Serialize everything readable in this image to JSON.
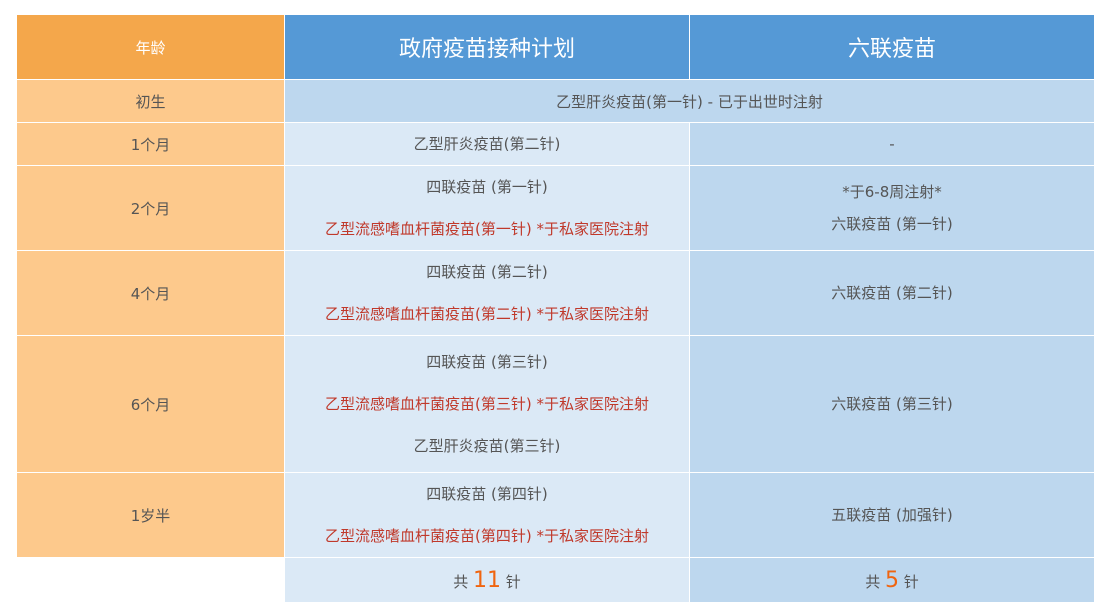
{
  "header": {
    "age": "年龄",
    "gov": "政府疫苗接种计划",
    "hex": "六联疫苗"
  },
  "rows": [
    {
      "age": "初生",
      "merged": "乙型肝炎疫苗(第一针) - 已于出世时注射"
    },
    {
      "age": "1个月",
      "gov": [
        "乙型肝炎疫苗(第二针)"
      ],
      "hex": [
        "-"
      ]
    },
    {
      "age": "2个月",
      "gov": [
        "四联疫苗 (第一针)",
        "乙型流感嗜血杆菌疫苗(第一针) *于私家医院注射"
      ],
      "hex": [
        "*于6-8周注射*",
        "六联疫苗 (第一针)"
      ]
    },
    {
      "age": "4个月",
      "gov": [
        "四联疫苗 (第二针)",
        "乙型流感嗜血杆菌疫苗(第二针) *于私家医院注射"
      ],
      "hex": [
        "六联疫苗 (第二针)"
      ]
    },
    {
      "age": "6个月",
      "gov": [
        "四联疫苗 (第三针)",
        "乙型流感嗜血杆菌疫苗(第三针) *于私家医院注射",
        "乙型肝炎疫苗(第三针)"
      ],
      "hex": [
        "六联疫苗 (第三针)"
      ]
    },
    {
      "age": "1岁半",
      "gov": [
        "四联疫苗 (第四针)",
        "乙型流感嗜血杆菌疫苗(第四针) *于私家医院注射"
      ],
      "hex": [
        "五联疫苗 (加强针)"
      ]
    }
  ],
  "totals": {
    "gov": {
      "prefix": "共",
      "count": "11",
      "suffix": "针"
    },
    "hex": {
      "prefix": "共",
      "count": "5",
      "suffix": "针"
    }
  },
  "colors": {
    "age_header": "#f4a74b",
    "age_cell": "#fdc98c",
    "plan_header": "#5599d6",
    "gov_cell": "#dbe9f6",
    "hex_cell": "#bdd7ee",
    "highlight_text": "#c0392b",
    "count_text": "#f0640f"
  }
}
